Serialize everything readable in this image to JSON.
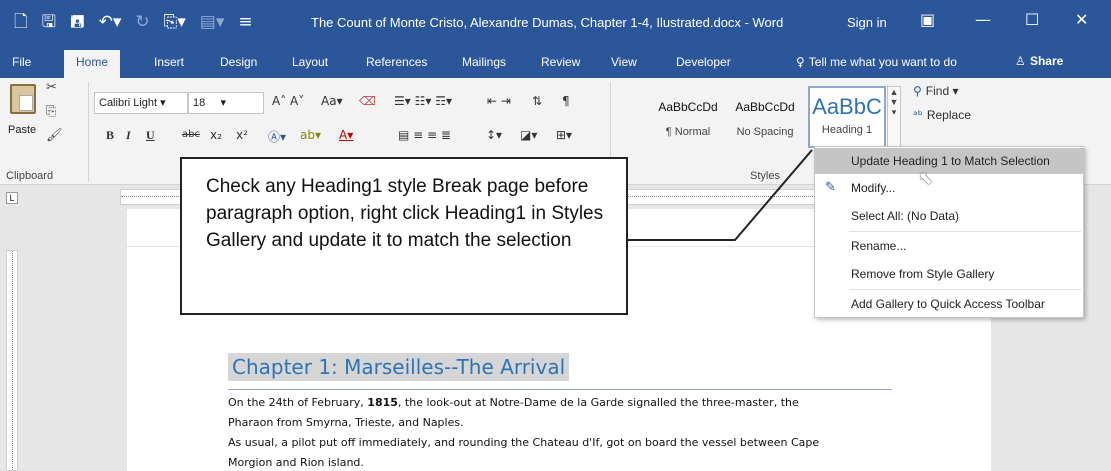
{
  "titlebar": {
    "document_title": "The Count of Monte Cristo, Alexandre Dumas, Chapter 1-4, Ilustrated.docx - Word",
    "sign_in": "Sign in",
    "qat": [
      "new-icon",
      "save-icon",
      "save-as-icon",
      "undo-icon",
      "redo-icon",
      "print-preview-icon",
      "customize-icon"
    ]
  },
  "tabs": {
    "file": "File",
    "items": [
      "Home",
      "Insert",
      "Design",
      "Layout",
      "References",
      "Mailings",
      "Review",
      "View",
      "Developer"
    ],
    "active": "Home",
    "tell_me": "Tell me what you want to do",
    "share": "Share"
  },
  "ribbon": {
    "paste": "Paste",
    "clipboard": "Clipboard",
    "font_name": "Calibri Light",
    "font_size": "18",
    "font_buttons": [
      "B",
      "I",
      "U",
      "abc",
      "x₂",
      "x²"
    ],
    "styles": [
      {
        "sample": "AaBbCcDd",
        "label": "¶ Normal"
      },
      {
        "sample": "AaBbCcDd",
        "label": "No Spacing"
      },
      {
        "sample": "AaBbC",
        "label": "Heading 1"
      }
    ],
    "styles_group": "Styles",
    "find": "Find",
    "replace": "Replace"
  },
  "callout": {
    "text": "Check any Heading1 style Break page before paragraph option, right click Heading1 in Styles Gallery and update it to match the selection"
  },
  "context_menu": {
    "items": [
      {
        "label": "Update Heading 1 to Match Selection",
        "highlighted": true
      },
      {
        "label": "Modify...",
        "highlighted": false
      },
      {
        "label": "Select All: (No Data)",
        "highlighted": false
      },
      {
        "label": "Rename...",
        "highlighted": false
      },
      {
        "label": "Remove from Style Gallery",
        "highlighted": false
      },
      {
        "label": "Add Gallery to Quick Access Toolbar",
        "highlighted": false
      }
    ]
  },
  "document": {
    "heading": "Chapter 1: Marseilles--The Arrival",
    "para1_line1_pre": "On the 24th of February, ",
    "para1_line1_bold": "1815",
    "para1_line1_post": ", the look-out at Notre-Dame de la Garde signalled the three-master, the",
    "para1_line2": "Pharaon from Smyrna, Trieste, and Naples.",
    "para2_line1": "As usual, a pilot put off immediately, and rounding the Chateau d'If, got on board the vessel between Cape",
    "para2_line2": "Morgion and Rion island."
  },
  "colors": {
    "word_blue": "#2b579a",
    "heading_blue": "#2e74b5",
    "menu_highlight": "#c5c5c5"
  }
}
